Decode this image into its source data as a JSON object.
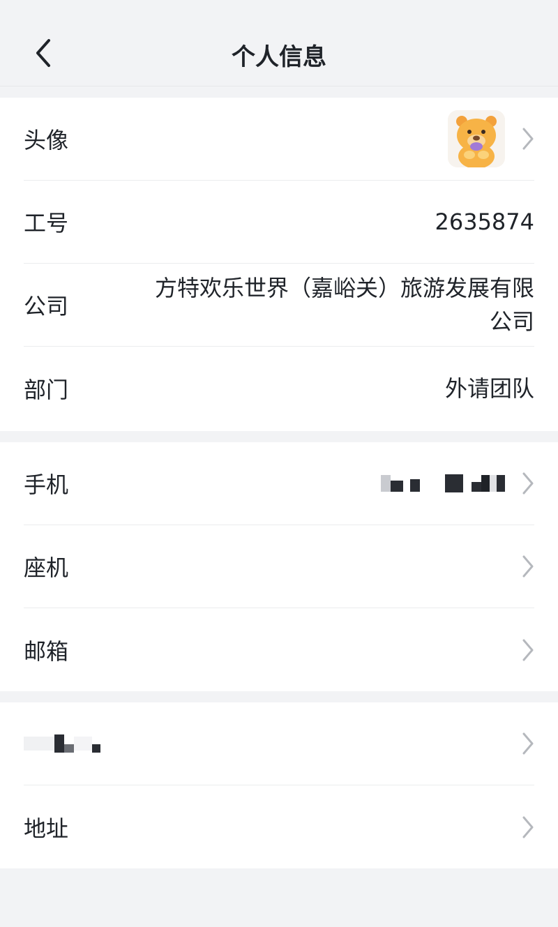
{
  "header": {
    "title": "个人信息",
    "back_icon": "chevron-left-icon"
  },
  "profile": {
    "avatar_label": "头像",
    "avatar_icon": "bear-avatar",
    "employee_id_label": "工号",
    "employee_id": "2635874",
    "company_label": "公司",
    "company": "方特欢乐世界（嘉峪关）旅游发展有限公司",
    "department_label": "部门",
    "department": "外请团队"
  },
  "contact": {
    "mobile_label": "手机",
    "mobile_value_masked": true,
    "landline_label": "座机",
    "email_label": "邮箱"
  },
  "other": {
    "masked_label": true,
    "address_label": "地址"
  },
  "colors": {
    "background": "#f2f3f5",
    "card": "#ffffff",
    "text": "#1f2329",
    "chevron": "#b5b8bd",
    "divider": "#ebecee"
  }
}
